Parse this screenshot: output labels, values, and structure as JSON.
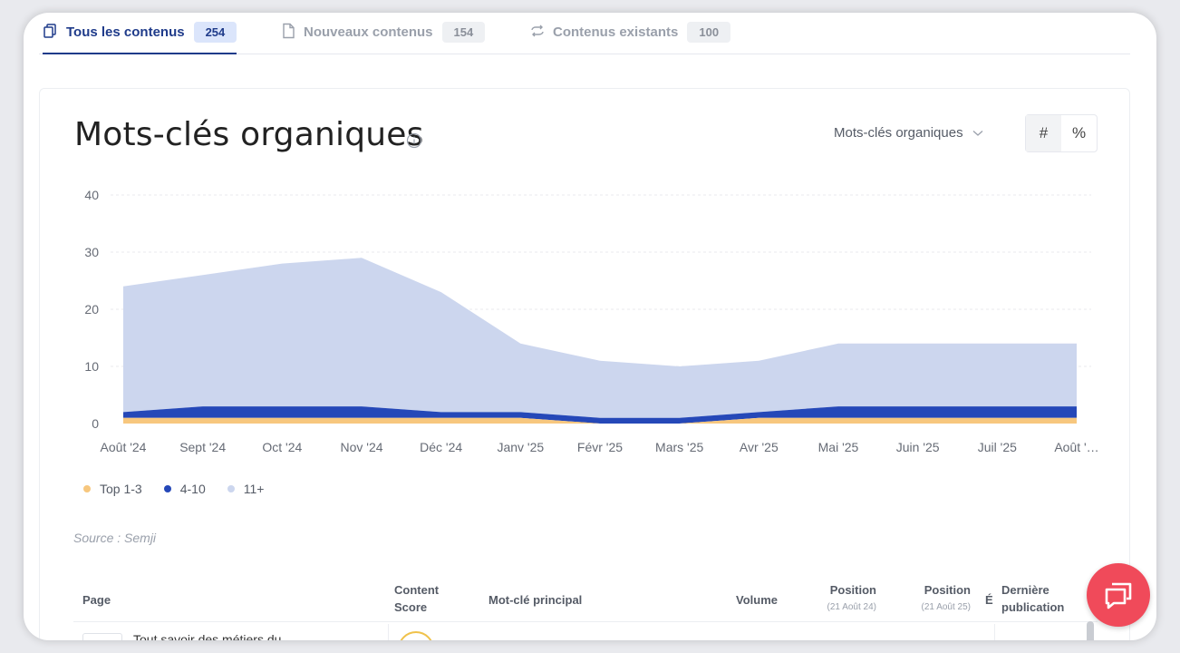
{
  "tabs": [
    {
      "label": "Tous les contenus",
      "count": "254",
      "icon": "copy-icon",
      "active": true
    },
    {
      "label": "Nouveaux contenus",
      "count": "154",
      "icon": "file-icon",
      "active": false
    },
    {
      "label": "Contenus existants",
      "count": "100",
      "icon": "refresh-icon",
      "active": false
    }
  ],
  "card": {
    "title": "Mots-clés organiques",
    "metric_select": "Mots-clés organiques",
    "toggle": {
      "count_label": "#",
      "percent_label": "%",
      "selected": "#"
    },
    "source": "Source : Semji"
  },
  "chart_data": {
    "type": "area",
    "stacked": true,
    "categories": [
      "Août '24",
      "Sept '24",
      "Oct '24",
      "Nov '24",
      "Déc '24",
      "Janv '25",
      "Févr '25",
      "Mars '25",
      "Avr '25",
      "Mai '25",
      "Juin '25",
      "Juil '25",
      "Août '…"
    ],
    "series": [
      {
        "name": "Top 1-3",
        "color": "#f7c77e",
        "values": [
          1,
          1,
          1,
          1,
          1,
          1,
          0,
          0,
          1,
          1,
          1,
          1,
          1
        ]
      },
      {
        "name": "4-10",
        "color": "#2548b8",
        "values": [
          1,
          2,
          2,
          2,
          1,
          1,
          1,
          1,
          1,
          2,
          2,
          2,
          2
        ]
      },
      {
        "name": "11+",
        "color": "#ccd6ee",
        "values": [
          22,
          23,
          25,
          26,
          21,
          12,
          10,
          9,
          9,
          11,
          11,
          11,
          11
        ]
      }
    ],
    "yticks": [
      "0",
      "10",
      "20",
      "30",
      "40"
    ],
    "ylim": [
      0,
      40
    ],
    "grid": true,
    "legend_position": "bottom-left"
  },
  "table": {
    "headers": {
      "page": "Page",
      "content_score": "Content Score",
      "main_keyword": "Mot-clé principal",
      "volume": "Volume",
      "position1": "Position",
      "position1_sub": "(21 Août 24)",
      "position2": "Position",
      "position2_sub": "(21 Août 25)",
      "evolution": "É",
      "last_publication": "Dernière publication"
    },
    "first_row_text": "Tout savoir des métiers du"
  },
  "chat_button": {
    "icon": "chat-icon",
    "color": "#f04a5a"
  }
}
